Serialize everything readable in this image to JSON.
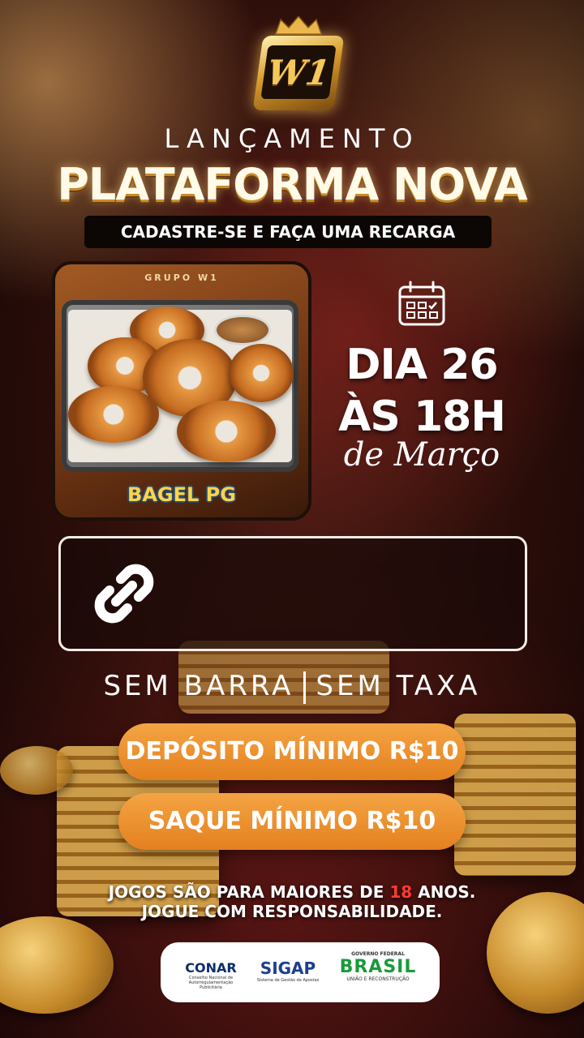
{
  "brand": {
    "logo_text": "W1"
  },
  "header": {
    "kicker": "LANÇAMENTO",
    "headline": "PLATAFORMA NOVA",
    "subtitle": "CADASTRE-SE E FAÇA UMA RECARGA"
  },
  "game": {
    "group_label": "GRUPO W1",
    "title": "BAGEL PG"
  },
  "event": {
    "line1": "DIA 26",
    "line2": "ÀS 18H",
    "month": "de Março",
    "icon": "calendar-icon"
  },
  "link": {
    "icon": "link-icon"
  },
  "tagline": {
    "left": "SEM BARRA",
    "right": "SEM TAXA"
  },
  "offers": {
    "deposit": "DEPÓSITO MÍNIMO R$10",
    "withdraw": "SAQUE MÍNIMO R$10"
  },
  "warning": {
    "line1_prefix": "JOGOS SÃO PARA MAIORES DE ",
    "age": "18",
    "line1_suffix": " ANOS.",
    "line2": "JOGUE COM RESPONSABILIDADE."
  },
  "partners": {
    "conar": {
      "name": "CONAR",
      "sub": "Conselho Nacional de Autorregulamentação Publicitária"
    },
    "sigap": {
      "name": "SIGAP",
      "sub": "Sistema de Gestão de Apostas"
    },
    "gov": {
      "top": "GOVERNO FEDERAL",
      "name": "BRASIL",
      "sub": "UNIÃO E RECONSTRUÇÃO"
    }
  },
  "colors": {
    "accent_orange": "#ef9433",
    "gold": "#f4c95a",
    "warning_red": "#ff3b30"
  }
}
